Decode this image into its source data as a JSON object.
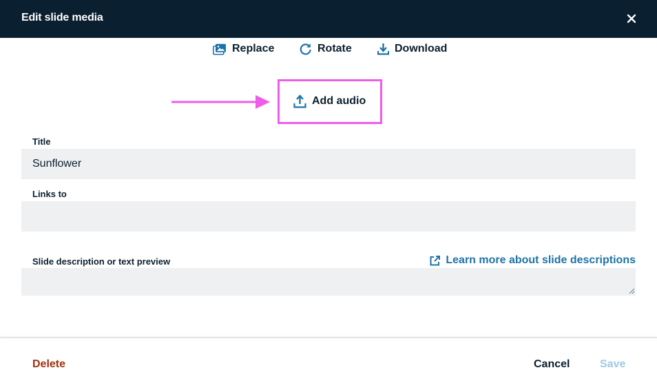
{
  "dialog": {
    "title": "Edit slide media",
    "close_icon": "close-icon"
  },
  "toolbar": {
    "replace_label": "Replace",
    "rotate_label": "Rotate",
    "download_label": "Download",
    "add_audio_label": "Add audio"
  },
  "form": {
    "title_label": "Title",
    "title_value": "Sunflower",
    "links_label": "Links to",
    "links_value": "",
    "description_label": "Slide description or text preview",
    "description_value": "",
    "learn_more_label": "Learn more about slide descriptions"
  },
  "footer": {
    "delete_label": "Delete",
    "cancel_label": "Cancel",
    "save_label": "Save"
  },
  "colors": {
    "header_bg": "#0a1f2f",
    "accent_blue": "#1e73a8",
    "highlight": "#ee5ce8",
    "delete_red": "#a3310f",
    "save_disabled": "#9fc9e3",
    "field_bg": "#eff0f2"
  }
}
